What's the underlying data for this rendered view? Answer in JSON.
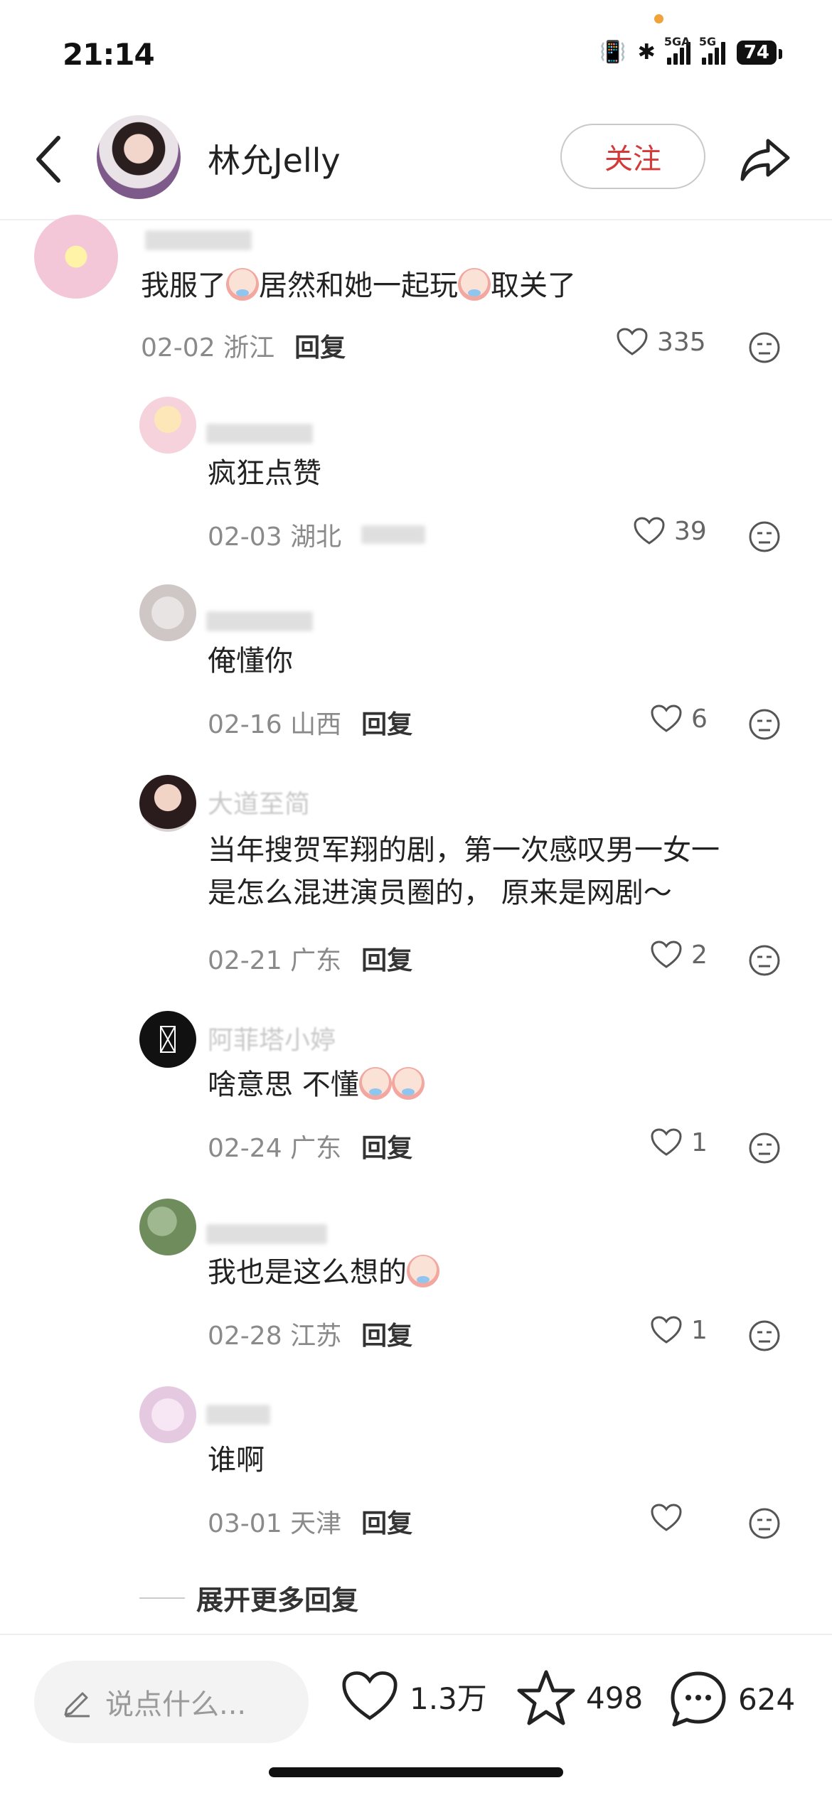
{
  "status_bar": {
    "time": "21:14",
    "battery": "74",
    "signal1": "5GA",
    "signal2": "5G"
  },
  "header": {
    "username": "林允Jelly",
    "follow_label": "关注"
  },
  "comments": [
    {
      "text_a": "我服了",
      "text_b": "居然和她一起玩",
      "text_c": "取关了",
      "date": "02-02",
      "location": "浙江",
      "reply": "回复",
      "likes": "335"
    },
    {
      "text": "疯狂点赞",
      "date": "02-03",
      "location": "湖北",
      "likes": "39"
    },
    {
      "text": "俺懂你",
      "date": "02-16",
      "location": "山西",
      "reply": "回复",
      "likes": "6"
    },
    {
      "username": "大道至简",
      "text_line1": "当年搜贺军翔的剧，第一次感叹男一女一",
      "text_line2": "是怎么混进演员圈的， 原来是网剧～",
      "date": "02-21",
      "location": "广东",
      "reply": "回复",
      "likes": "2"
    },
    {
      "username": "阿菲塔小婷",
      "text": "啥意思 不懂",
      "date": "02-24",
      "location": "广东",
      "reply": "回复",
      "likes": "1"
    },
    {
      "text": "我也是这么想的",
      "date": "02-28",
      "location": "江苏",
      "reply": "回复",
      "likes": "1"
    },
    {
      "text": "谁啊",
      "date": "03-01",
      "location": "天津",
      "reply": "回复",
      "likes": ""
    }
  ],
  "expand_label": "展开更多回复",
  "bottom_bar": {
    "input_placeholder": "说点什么...",
    "likes": "1.3万",
    "favorites": "498",
    "comments": "624"
  }
}
